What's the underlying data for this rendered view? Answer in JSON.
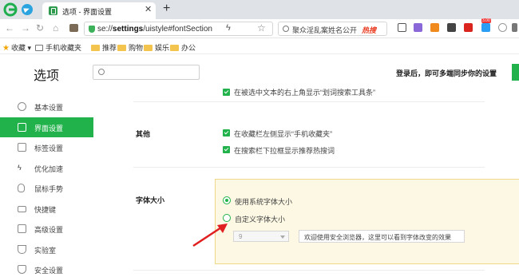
{
  "browser": {
    "tab_title": "选项 - 界面设置",
    "new_tab_label": "+",
    "tab_close_label": "✕",
    "url_prefix": "se://",
    "url_bold": "settings",
    "url_rest": "/uistyle#fontSection",
    "search_text": "聚众淫乱案姓名公开",
    "search_hot_label": "热搜"
  },
  "bookmarks": {
    "favorites_label": "收藏",
    "items": [
      "手机收藏夹",
      "推荐",
      "购物",
      "娱乐",
      "办公"
    ]
  },
  "header": {
    "title": "选项",
    "search_placeholder": "",
    "login_text": "登录后，即可多端同步你的设置"
  },
  "sidebar": {
    "items": [
      {
        "label": "基本设置",
        "icon": "settings-icon"
      },
      {
        "label": "界面设置",
        "icon": "interface-icon"
      },
      {
        "label": "标签设置",
        "icon": "tab-icon"
      },
      {
        "label": "优化加速",
        "icon": "lightning-icon"
      },
      {
        "label": "鼠标手势",
        "icon": "mouse-icon"
      },
      {
        "label": "快捷键",
        "icon": "keyboard-icon"
      },
      {
        "label": "高级设置",
        "icon": "advanced-icon"
      },
      {
        "label": "实验室",
        "icon": "lab-icon"
      },
      {
        "label": "安全设置",
        "icon": "shield-icon"
      }
    ],
    "active_index": 1
  },
  "content": {
    "top_partial_option": "在被选中文本的右上角显示“划词搜索工具条”",
    "other_section": {
      "label": "其他",
      "options": [
        {
          "text": "在收藏栏左侧显示“手机收藏夹”",
          "checked": true
        },
        {
          "text": "在搜索栏下拉框显示推荐热搜词",
          "checked": true
        }
      ]
    },
    "font_section": {
      "label": "字体大小",
      "radio_system": "使用系统字体大小",
      "radio_custom": "自定义字体大小",
      "selected": "system",
      "size_value": "9",
      "preview_text": "欢迎使用安全浏览器，这里可以看到字体改变的效果"
    }
  },
  "colors": {
    "accent": "#21b24b",
    "panel_bg": "#fdf8e3",
    "arrow": "#e02020"
  }
}
